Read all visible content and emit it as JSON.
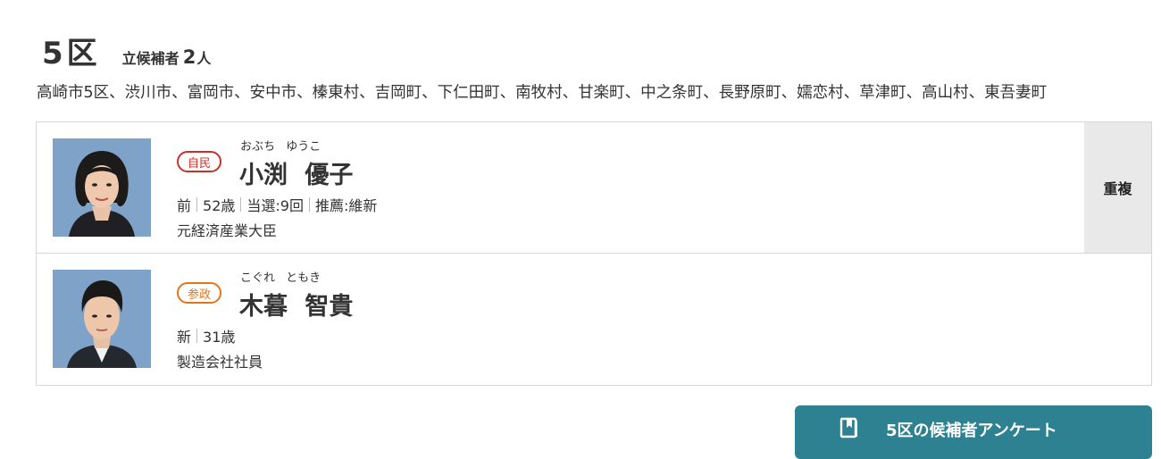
{
  "district": {
    "title": "5区",
    "candidate_count_label": "立候補者",
    "candidate_count": "2",
    "candidate_count_unit": "人",
    "areas": "高崎市5区、渋川市、富岡市、安中市、榛東村、吉岡町、下仁田町、南牧村、甘楽町、中之条町、長野原町、嬬恋村、草津町、高山村、東吾妻町"
  },
  "candidates": [
    {
      "party": "自民",
      "party_color": "#c8302a",
      "furigana": "おぶち ゆうこ",
      "name": "小渕 優子",
      "status": "前",
      "age": "52歳",
      "elected": "当選:9回",
      "endorsement": "推薦:維新",
      "career": "元経済産業大臣",
      "duplicate": "重複"
    },
    {
      "party": "参政",
      "party_color": "#e8731d",
      "furigana": "こぐれ ともき",
      "name": "木暮 智貴",
      "status": "新",
      "age": "31歳",
      "career": "製造会社社員"
    }
  ],
  "survey_button": {
    "label": "5区の候補者アンケート",
    "icon": "survey-document-icon",
    "color": "#2d8191"
  }
}
